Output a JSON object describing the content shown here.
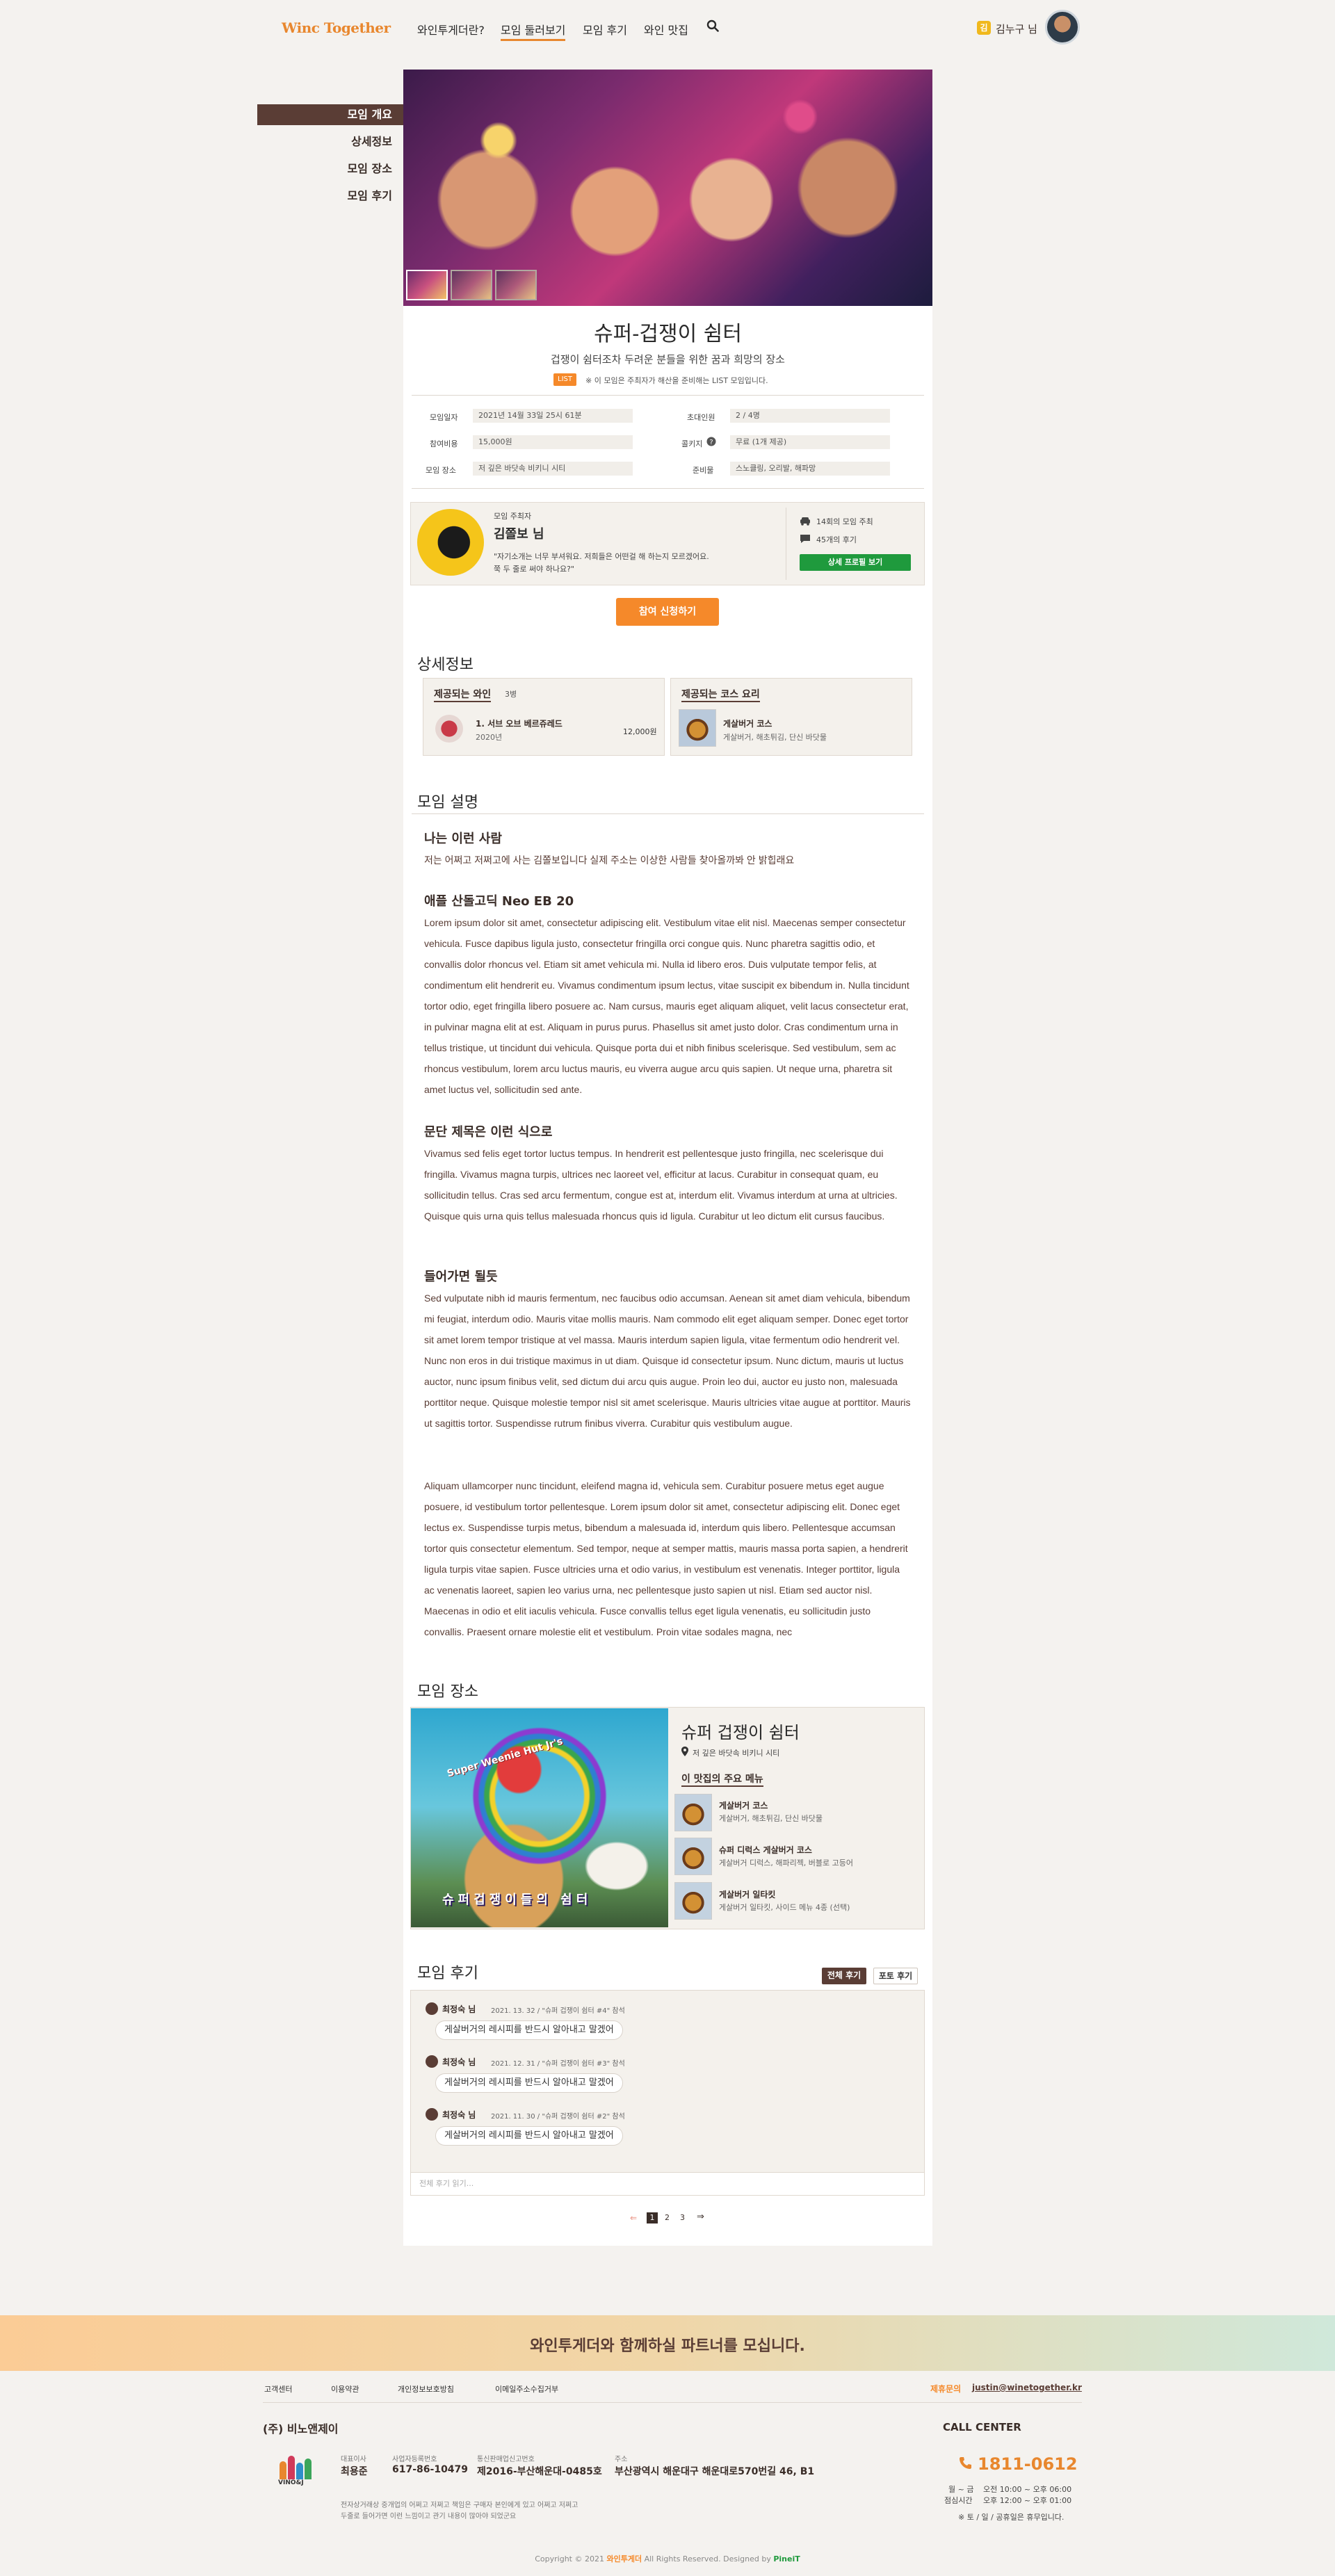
{
  "header": {
    "logo": "Winc Together",
    "nav": [
      "와인투게더란?",
      "모임 둘러보기",
      "모임 후기",
      "와인 맛집"
    ],
    "active_nav": "모임 둘러보기",
    "user_badge": "김",
    "user_name": "김누구 님"
  },
  "side_nav": [
    "모임 개요",
    "상세정보",
    "모임 장소",
    "모임 후기"
  ],
  "meetup": {
    "title": "슈퍼-겁쟁이 쉼터",
    "subtitle": "겁쟁이 쉼터조차 두려운 분들을 위한 꿈과 희망의 장소",
    "list_tag": "LIST",
    "list_note": "※ 이 모임은 주최자가 해산을 준비해는 LIST 모임입니다.",
    "info": [
      {
        "label": "모임일자",
        "value": "2021년 14월 33일 25시 61분"
      },
      {
        "label": "초대인원",
        "value": "2 / 4명"
      },
      {
        "label": "참여비용",
        "value": "15,000원"
      },
      {
        "label": "콜키지",
        "value": "무료 (1개 제공)"
      },
      {
        "label": "모임 장소",
        "value": "저 깊은 바닷속 비키니 시티"
      },
      {
        "label": "준비물",
        "value": "스노클링, 오리발, 해파망"
      }
    ],
    "corkage_help_icon": "question-circle-icon"
  },
  "host": {
    "role": "모임 주최자",
    "name": "김쫄보 님",
    "quote_line1": "\"자기소개는 너무 부셔워요. 저희들은 어떤걸 해 하는지 모르겠어요.",
    "quote_line2": "쭉 두 줄로 써야 하나요?\"",
    "stat_meetups": "14회의 모임 주최",
    "stat_reviews": "45개의 후기",
    "profile_button": "상세 프로필 보기",
    "stat_meetups_icon": "car-icon",
    "stat_reviews_icon": "chat-bubble-icon"
  },
  "apply_button": "참여 신청하기",
  "detail": {
    "heading": "상세정보",
    "wine_card_title": "제공되는 와인",
    "wine_count": "3병",
    "wine_name": "1. 서브 오브 베르쥬레드",
    "wine_year": "2020년",
    "wine_price": "12,000원",
    "course_card_title": "제공되는 코스 요리",
    "course_name": "게살버거 코스",
    "course_desc": "게살버거, 해초튀김, 단신 바닷물"
  },
  "description": {
    "heading": "모임 설명",
    "h1": "나는 이런 사람",
    "p1": "저는 어쩌고 저쩌고에 사는 김쫄보입니다 실제 주소는 이상한 사람들 찾아올까봐 안 밝힙래요",
    "h2": "애플 산돌고딕 Neo EB 20",
    "p2": "Lorem ipsum dolor sit amet, consectetur adipiscing elit. Vestibulum vitae elit nisl. Maecenas semper consectetur vehicula. Fusce dapibus ligula justo, consectetur fringilla orci congue quis. Nunc pharetra sagittis odio, et convallis dolor rhoncus vel. Etiam sit amet vehicula mi. Nulla id libero eros. Duis vulputate tempor felis, at condimentum elit hendrerit eu. Vivamus condimentum ipsum lectus, vitae suscipit ex bibendum in. Nulla tincidunt tortor odio, eget fringilla libero posuere ac. Nam cursus, mauris eget aliquam aliquet, velit lacus consectetur erat, in pulvinar magna elit at est. Aliquam in purus purus. Phasellus sit amet justo dolor. Cras condimentum urna in tellus tristique, ut tincidunt dui vehicula. Quisque porta dui et nibh finibus scelerisque. Sed vestibulum, sem ac rhoncus vestibulum, lorem arcu luctus mauris, eu viverra augue arcu quis sapien. Ut neque urna, pharetra sit amet luctus vel, sollicitudin sed ante.",
    "h3": "문단 제목은 이런 식으로",
    "p3": "Vivamus sed felis eget tortor luctus tempus. In hendrerit est pellentesque justo fringilla, nec scelerisque dui fringilla. Vivamus magna turpis, ultrices nec laoreet vel, efficitur at lacus. Curabitur in consequat quam, eu sollicitudin tellus. Cras sed arcu fermentum, congue est at, interdum elit. Vivamus interdum at urna at ultricies. Quisque quis urna quis tellus malesuada rhoncus quis id ligula. Curabitur ut leo dictum elit cursus faucibus.",
    "h4": "들어가면 될듯",
    "p4": "Sed vulputate nibh id mauris fermentum, nec faucibus odio accumsan. Aenean sit amet diam vehicula, bibendum mi feugiat, interdum odio. Mauris vitae mollis mauris. Nam commodo elit eget aliquam semper. Donec eget tortor sit amet lorem tempor tristique at vel massa. Mauris interdum sapien ligula, vitae fermentum odio hendrerit vel. Nunc non eros in dui tristique maximus in ut diam. Quisque id consectetur ipsum. Nunc dictum, mauris ut luctus auctor, nunc ipsum finibus velit, sed dictum dui arcu quis augue. Proin leo dui, auctor eu justo non, malesuada porttitor neque. Quisque molestie tempor nisl sit amet scelerisque. Mauris ultricies vitae augue at porttitor. Mauris ut sagittis tortor. Suspendisse rutrum finibus viverra. Curabitur quis vestibulum augue.",
    "p5": "Aliquam ullamcorper nunc tincidunt, eleifend magna id, vehicula sem. Curabitur posuere metus eget augue posuere, id vestibulum tortor pellentesque. Lorem ipsum dolor sit amet, consectetur adipiscing elit. Donec eget lectus ex. Suspendisse turpis metus, bibendum a malesuada id, interdum quis libero. Pellentesque accumsan tortor quis consectetur elementum. Sed tempor, neque at semper mattis, mauris massa porta sapien, a hendrerit ligula turpis vitae sapien. Fusce ultricies urna et odio varius, in vestibulum est venenatis. Integer porttitor, ligula ac venenatis laoreet, sapien leo varius urna, nec pellentesque justo sapien ut nisl. Etiam sed auctor nisl. Maecenas in odio et elit iaculis vehicula. Fusce convallis tellus eget ligula venenatis, eu sollicitudin justo convallis. Praesent ornare molestie elit et vestibulum. Proin vitae sodales magna, nec"
  },
  "place": {
    "heading": "모임 장소",
    "image_caption": "슈퍼겁쟁이들의 쉼터",
    "sign_text": "Super Weenie Hut Jr's",
    "name": "슈퍼 겁쟁이 쉼터",
    "address": "저 깊은 바닷속 비키니 시티",
    "address_icon": "map-pin-icon",
    "menu_title": "이 맛집의 주요 메뉴",
    "menu": [
      {
        "name": "게살버거 코스",
        "desc": "게살버거, 해초튀김, 단신 바닷물"
      },
      {
        "name": "슈퍼 디럭스 게살버거 코스",
        "desc": "게살버거 디럭스, 해파리젝, 버블로 고등어"
      },
      {
        "name": "게살버거 일타킷",
        "desc": "게살버거 일타킷, 사이드 메뉴 4종 (선택)"
      }
    ]
  },
  "reviews": {
    "heading": "모임 후기",
    "tab_all": "전체 후기",
    "tab_photo": "포토 후기",
    "items": [
      {
        "author": "최정숙 님",
        "meta": "2021. 13. 32 / \"슈퍼 겁쟁이 쉼터 #4\" 참석",
        "text": "게살버거의 레시피를 반드시 알아내고 말겠어"
      },
      {
        "author": "최정숙 님",
        "meta": "2021. 12. 31 / \"슈퍼 겁쟁이 쉼터 #3\" 참석",
        "text": "게살버거의 레시피를 반드시 알아내고 말겠어"
      },
      {
        "author": "최정숙 님",
        "meta": "2021. 11. 30 / \"슈퍼 겁쟁이 쉼터 #2\" 참석",
        "text": "게살버거의 레시피를 반드시 알아내고 말겠어"
      }
    ],
    "more": "전체 후기 읽기...",
    "pagination": [
      "1",
      "2",
      "3"
    ],
    "current_page": "1"
  },
  "footer": {
    "banner": "와인투게더와 함께하실 파트너를 모십니다.",
    "links": [
      "고객센터",
      "이용약관",
      "개인정보보호방침",
      "이메일주소수집거부"
    ],
    "partner_label": "제휴문의",
    "partner_email": "justin@winetogether.kr",
    "company": "(주) 비노앤제이",
    "logo_text": "VINO&J",
    "ceo_label": "대표이사",
    "ceo": "최용준",
    "biz_label": "사업자등록번호",
    "biz": "617-86-10479",
    "mail_order_label": "통신판매업신고번호",
    "mail_order": "제2016-부산해운대-0485호",
    "addr_label": "주소",
    "addr": "부산광역시 해운대구 해운대로570번길 46, B1",
    "notice1": "전자상거래상 중개업의 어쩌고 저쩌고 책임은 구매자 본인에게 있고 어쩌고 저쩌고",
    "notice2": "두줄로 들어가면 이런 느낌이고 관기 내용이 많아야 되었군요",
    "call_center": "CALL CENTER",
    "phone": "1811-0612",
    "hours_days": "월 ~ 금",
    "hours_weekday": "오전 10:00 ~ 오후 06:00",
    "lunch_label": "점심시간",
    "lunch": "오후 12:00 ~ 오후 01:00",
    "holiday": "※ 토 / 일 / 공휴일은 휴무입니다.",
    "copyright_pre": "Copyright © 2021",
    "copyright_brand": "와인투게더",
    "copyright_mid": "All Rights Reserved. Designed by",
    "copyright_designer": "PineiT"
  },
  "colors": {
    "accent": "#f5892a",
    "brown": "#5a3d35",
    "green": "#1f9a3d",
    "phone": "#e8872e"
  }
}
